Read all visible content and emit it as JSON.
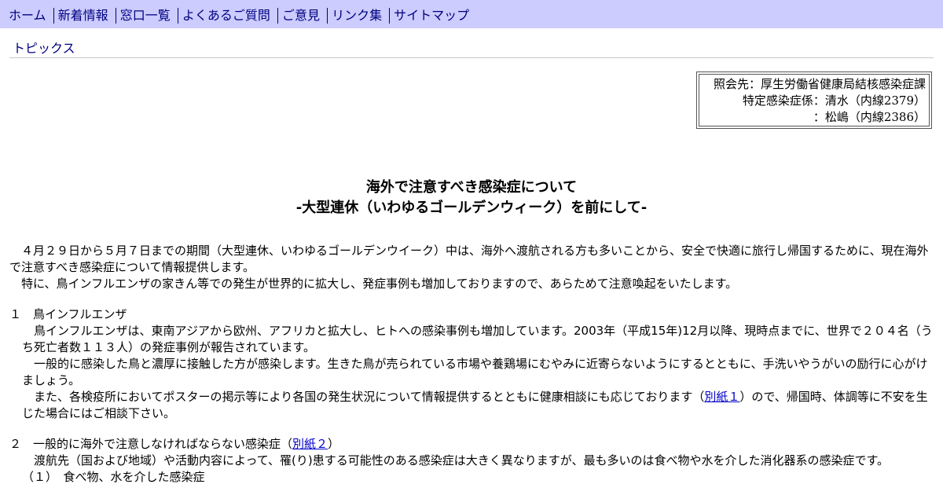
{
  "nav": {
    "items": [
      "ホーム",
      "新着情報",
      "窓口一覧",
      "よくあるご質問",
      "ご意見",
      "リンク集",
      "サイトマップ"
    ]
  },
  "topics": "トピックス",
  "contact": {
    "line1": "照会先：厚生労働省健康局結核感染症課",
    "line2": "特定感染症係：清水（内線2379）",
    "line3": "：松嶋（内線2386）"
  },
  "title": {
    "line1": "海外で注意すべき感染症について",
    "line2": "-大型連休（いわゆるゴールデンウィーク）を前にして-"
  },
  "intro": {
    "p1": "　４月２９日から５月７日までの期間（大型連休、いわゆるゴールデンウイーク）中は、海外へ渡航される方も多いことから、安全で快適に旅行し帰国するために、現在海外で注意すべき感染症について情報提供します。",
    "p2": "　特に、鳥インフルエンザの家きん等での発生が世界的に拡大し、発症事例も増加しておりますので、あらためて注意喚起をいたします。"
  },
  "section1": {
    "heading": "１　鳥インフルエンザ",
    "p1": "　鳥インフルエンザは、東南アジアから欧州、アフリカと拡大し、ヒトへの感染事例も増加しています。2003年（平成15年)12月以降、現時点までに、世界で２０４名（うち死亡者数１１３人）の発症事例が報告されています。",
    "p2": "　一般的に感染した鳥と濃厚に接触した方が感染します。生きた鳥が売られている市場や養鶏場にむやみに近寄らないようにするとともに、手洗いやうがいの励行に心がけましょう。",
    "p3_before": "　また、各検疫所においてポスターの掲示等により各国の発生状況について情報提供するとともに健康相談にも応じております（",
    "p3_link": "別紙１",
    "p3_after": "）ので、帰国時、体調等に不安を生じた場合にはご相談下さい。"
  },
  "section2": {
    "heading_before": "２　一般的に海外で注意しなければならない感染症（",
    "heading_link": "別紙２",
    "heading_after": "）",
    "p1": "　渡航先（国および地域）や活動内容によって、罹(り)患する可能性のある感染症は大きく異なりますが、最も多いのは食べ物や水を介した消化器系の感染症です。",
    "sub1": "（１）　食べ物、水を介した感染症"
  }
}
